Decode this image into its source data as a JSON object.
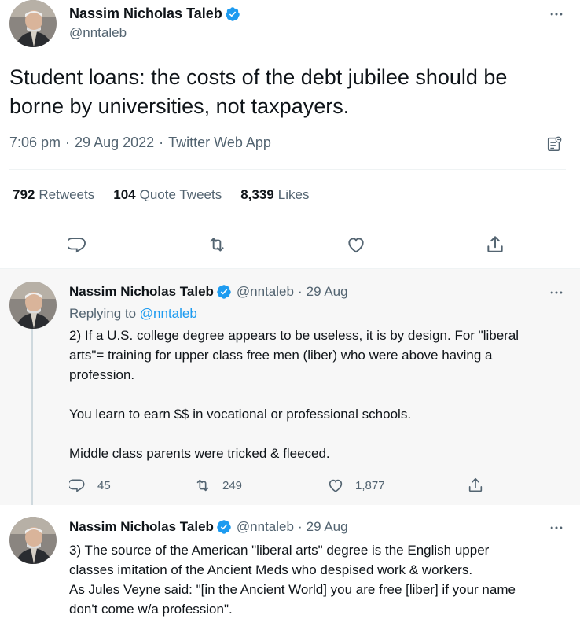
{
  "main_tweet": {
    "author_name": "Nassim Nicholas Taleb",
    "handle": "@nntaleb",
    "text": "Student loans: the costs of the debt jubilee should be borne by universities, not taxpayers.",
    "time": "7:06 pm",
    "date": "29 Aug 2022",
    "source": "Twitter Web App",
    "separator": "·",
    "stats": {
      "retweets_count": "792",
      "retweets_label": "Retweets",
      "quotes_count": "104",
      "quotes_label": "Quote Tweets",
      "likes_count": "8,339",
      "likes_label": "Likes"
    },
    "icons": [
      "reply-icon",
      "retweet-icon",
      "like-icon",
      "share-icon",
      "analytics-icon",
      "more-icon",
      "verified-badge-icon"
    ]
  },
  "replies": [
    {
      "author_name": "Nassim Nicholas Taleb",
      "handle": "@nntaleb",
      "separator": "·",
      "date": "29 Aug",
      "replying_prefix": "Replying to",
      "replying_to": "@nntaleb",
      "text_lines": [
        "2) If a U.S. college degree appears to be useless, it is by design. For \"liberal",
        "arts\"= training for upper class free men (liber) who were above having a",
        "profession.",
        "You learn to earn $$ in vocational or professional schools.",
        "Middle class parents were tricked & fleeced."
      ],
      "reply_count": "45",
      "retweet_count": "249",
      "like_count": "1,877"
    },
    {
      "author_name": "Nassim Nicholas Taleb",
      "handle": "@nntaleb",
      "separator": "·",
      "date": "29 Aug",
      "text_lines": [
        "3) The source of the American \"liberal arts\" degree is the English upper",
        "classes imitation of the Ancient Meds who despised work & workers.",
        "As Jules Veyne said: \"[in the Ancient World] you are free [liber] if your name",
        "don't come w/a profession\"."
      ]
    }
  ],
  "colors": {
    "accent": "#1d9bf0",
    "muted_text": "#536471",
    "reply_bg": "#f7f7f7",
    "divider": "#eff3f4"
  }
}
